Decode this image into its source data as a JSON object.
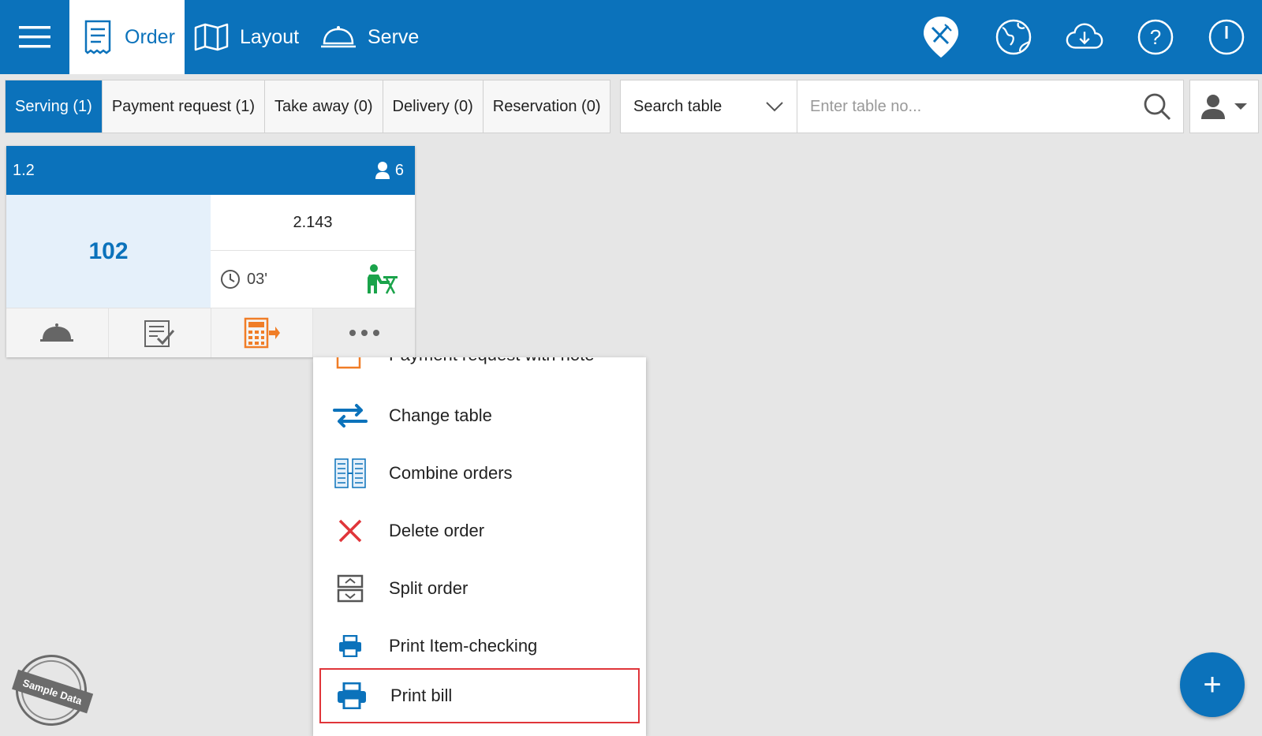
{
  "topbar": {
    "nav": [
      {
        "label": "Order",
        "icon": "receipt-icon",
        "active": true
      },
      {
        "label": "Layout",
        "icon": "map-icon"
      },
      {
        "label": "Serve",
        "icon": "cloche-icon"
      }
    ],
    "icons": [
      "restaurant-pin-icon",
      "globe-icon",
      "cloud-download-icon",
      "help-icon",
      "power-icon"
    ]
  },
  "tabs": [
    {
      "label": "Serving (1)",
      "active": true
    },
    {
      "label": "Payment request (1)"
    },
    {
      "label": "Take away (0)"
    },
    {
      "label": "Delivery (0)"
    },
    {
      "label": "Reservation (0)"
    }
  ],
  "search": {
    "select_label": "Search table",
    "placeholder": "Enter table no..."
  },
  "card": {
    "table": "1.2",
    "guests": "6",
    "order_no": "102",
    "amount": "2.143",
    "elapsed": "03'"
  },
  "menu": {
    "items": [
      {
        "label": "Payment request with note",
        "icon": "payment-note-icon"
      },
      {
        "label": "Change table",
        "icon": "swap-arrows-icon"
      },
      {
        "label": "Combine orders",
        "icon": "combine-orders-icon"
      },
      {
        "label": "Delete order",
        "icon": "close-x-icon"
      },
      {
        "label": "Split order",
        "icon": "split-tray-icon"
      },
      {
        "label": "Print Item-checking",
        "icon": "printer-icon"
      },
      {
        "label": "Print bill",
        "icon": "printer-icon",
        "highlighted": true
      }
    ]
  },
  "watermark": {
    "text": "Sample Data"
  },
  "fab": {
    "label": "+"
  },
  "colors": {
    "primary": "#0b72bb",
    "highlight": "#e0353a",
    "calc_orange": "#f07d27",
    "status_green": "#1aa34a"
  }
}
